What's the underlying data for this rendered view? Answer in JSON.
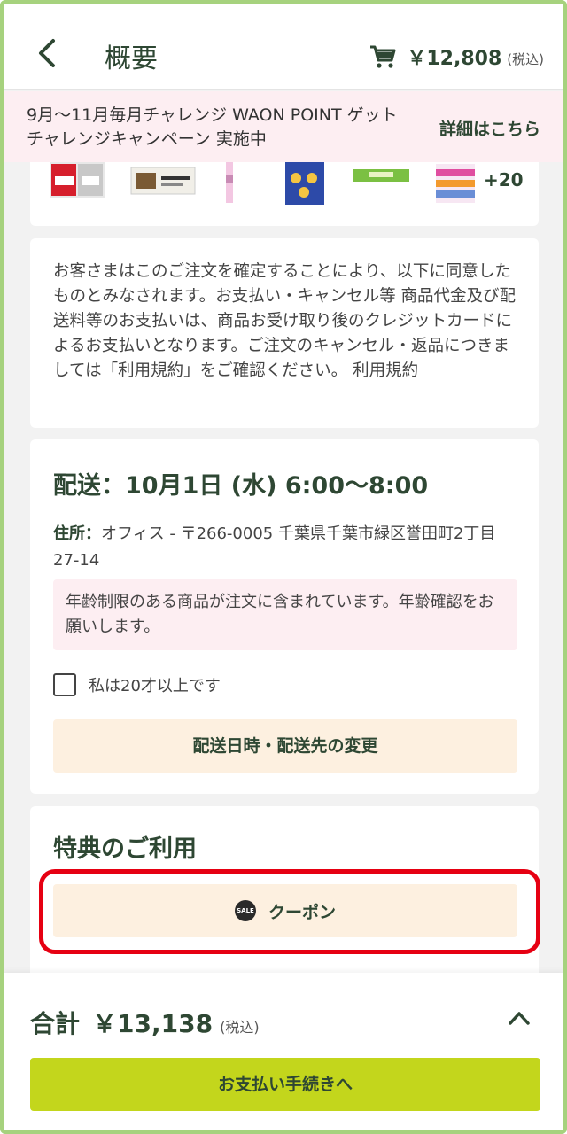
{
  "header": {
    "title": "概要",
    "cart_total": "￥12,808",
    "cart_tax": "(税込)"
  },
  "banner": {
    "text": "9月～11月毎月チャレンジ WAON POINT ゲットチャレンジキャンペーン 実施中",
    "link": "詳細はこちら"
  },
  "products": {
    "more": "+20"
  },
  "terms": {
    "text": "お客さまはこのご注文を確定することにより、以下に同意したものとみなされます。お支払い・キャンセル等 商品代金及び配送料等のお支払いは、商品お受け取り後のクレジットカードによるお支払いとなります。ご注文のキャンセル・返品につきましては「利用規約」をご確認ください。",
    "link": "利用規約"
  },
  "delivery": {
    "title": "配送：10月1日 (水) 6:00～8:00",
    "address_label": "住所：",
    "address": "オフィス - 〒266-0005 千葉県千葉市緑区誉田町2丁目27-14",
    "age_notice": "年齢制限のある商品が注文に含まれています。年齢確認をお願いします。",
    "age_check": "私は20才以上です",
    "change_button": "配送日時・配送先の変更"
  },
  "benefits": {
    "title": "特典のご利用",
    "coupon_button": "クーポン",
    "sale_icon_text": "SALE"
  },
  "footer": {
    "label": "合計",
    "total": "￥13,138",
    "tax": "(税込)",
    "pay_button": "お支払い手続きへ"
  },
  "colors": {
    "frame": "#a6d27e",
    "brand_text": "#2e4733",
    "banner_bg": "#fdeef2",
    "button_bg": "#fdf0e0",
    "pay_button_bg": "#c3d61c",
    "highlight": "#e60012"
  }
}
